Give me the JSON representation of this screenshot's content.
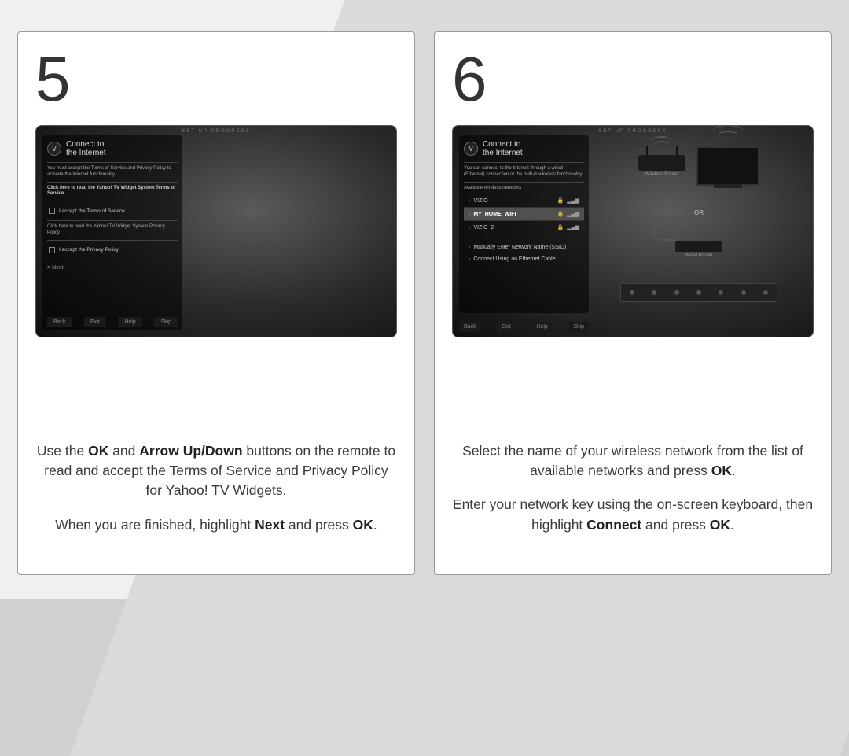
{
  "pages": {
    "left": {
      "number": "5",
      "progress_label": "SET-UP PROGRESS",
      "panel_title_line1": "Connect to",
      "panel_title_line2": "the Internet",
      "notice": "You must accept the Terms of Service and Privacy Policy to activate the Internet functionality.",
      "link_tos": "Click here to read the Yahoo! TV Widget System Terms of Service",
      "accept_tos": "I accept the Terms of Service.",
      "link_pp": "Click here to read the Yahoo! TV Widget System Privacy Policy",
      "accept_pp": "I accept the Privacy Policy.",
      "next_label": "> Next",
      "buttons": {
        "back": "Back",
        "exit": "Exit",
        "help": "Help",
        "skip": "Skip"
      },
      "instruction_p1_a": "Use the ",
      "instruction_p1_b": "OK",
      "instruction_p1_c": " and ",
      "instruction_p1_d": "Arrow Up/Down",
      "instruction_p1_e": " buttons on the remote to read and accept the Terms of Service and Privacy Policy for Yahoo! TV Widgets.",
      "instruction_p2_a": "When you are finished, highlight ",
      "instruction_p2_b": "Next",
      "instruction_p2_c": " and press ",
      "instruction_p2_d": "OK",
      "instruction_p2_e": "."
    },
    "right": {
      "number": "6",
      "progress_label": "SET-UP PROGRESS",
      "panel_title_line1": "Connect to",
      "panel_title_line2": "the Internet",
      "notice": "You can connect to the Internet through a wired (Ethernet) connection or the built-in wireless functionality.",
      "available_label": "Available wireless networks",
      "networks": [
        {
          "name": "VIZIO",
          "locked": true
        },
        {
          "name": "MY_HOME_WIFI",
          "locked": true,
          "selected": true
        },
        {
          "name": "VIZIO_2",
          "locked": true
        }
      ],
      "opt_manual": "Manually Enter Network Name (SSID)",
      "opt_ethernet": "Connect Using an Ethernet Cable",
      "illus": {
        "wireless_label": "Wireless Router",
        "or_label": "OR",
        "wired_label": "Wired Router"
      },
      "buttons": {
        "back": "Back",
        "exit": "Exit",
        "help": "Help",
        "skip": "Skip"
      },
      "instruction_p1_a": "Select the name of your wireless network from the list of available networks and press ",
      "instruction_p1_b": "OK",
      "instruction_p1_c": ".",
      "instruction_p2_a": "Enter your network key using the on-screen keyboard, then highlight ",
      "instruction_p2_b": "Connect",
      "instruction_p2_c": " and press ",
      "instruction_p2_d": "OK",
      "instruction_p2_e": "."
    }
  }
}
